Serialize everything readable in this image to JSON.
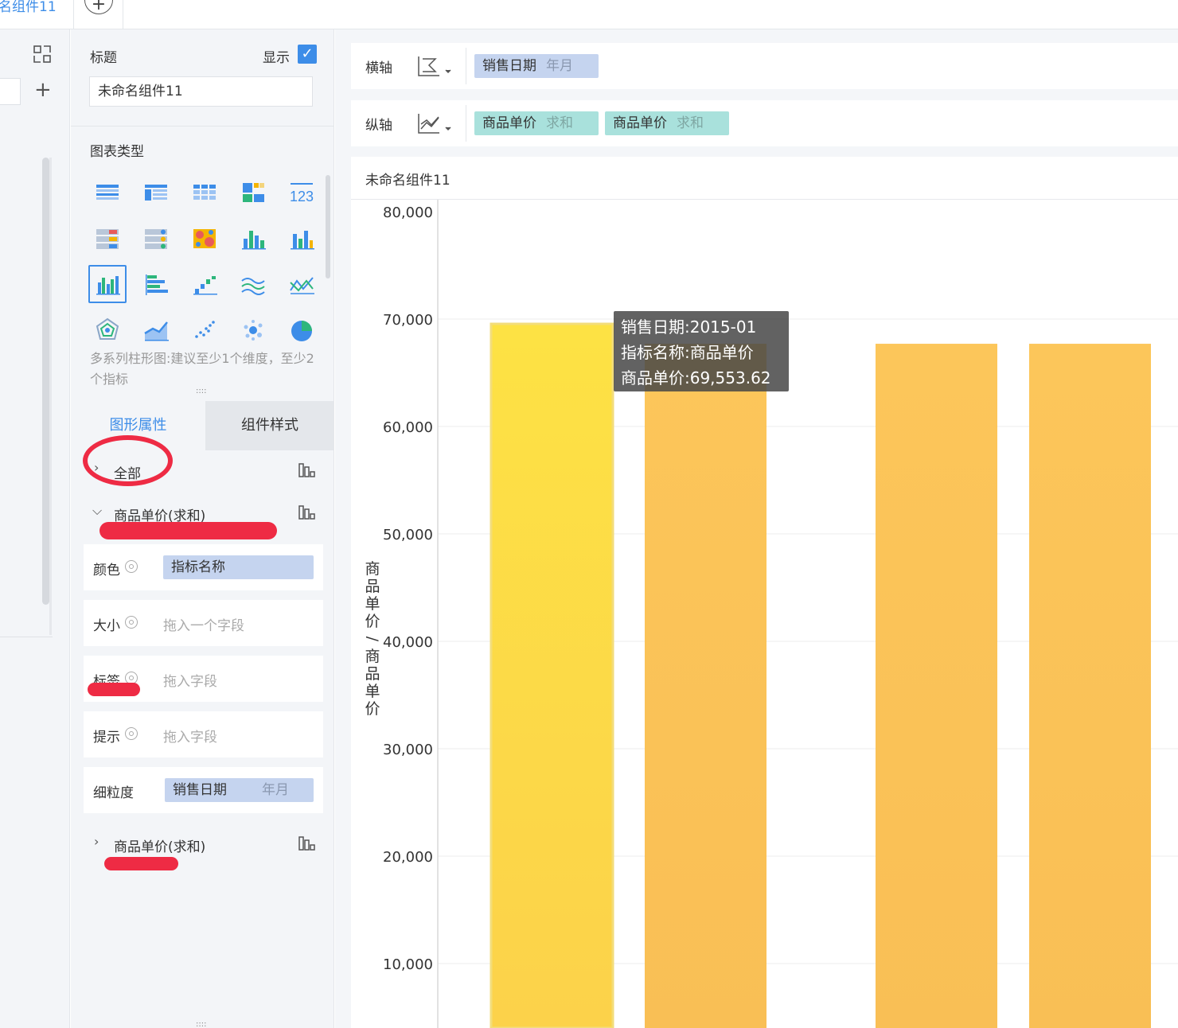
{
  "tabbar": {
    "tab_label": "名组件11",
    "add_label": "+"
  },
  "panel": {
    "title_label": "标题",
    "show_label": "显示",
    "title_value": "未命名组件11",
    "chart_type_label": "图表类型",
    "chart_type_desc": "多系列柱形图:建议至少1个维度，至少2个指标",
    "tabs": {
      "shape": "图形属性",
      "style": "组件样式"
    },
    "all_label": "全部",
    "series1_label": "商品单价(求和)",
    "series2_label": "商品单价(求和)",
    "fields": {
      "color": {
        "name": "颜色",
        "value": "指标名称"
      },
      "size": {
        "name": "大小",
        "placeholder": "拖入一个字段"
      },
      "label": {
        "name": "标签",
        "placeholder": "拖入字段"
      },
      "tip": {
        "name": "提示",
        "placeholder": "拖入字段"
      },
      "granularity": {
        "name": "细粒度",
        "value": "销售日期",
        "sub": "年月"
      }
    }
  },
  "axis": {
    "x_label": "横轴",
    "y_label": "纵轴",
    "x_pill": {
      "name": "销售日期",
      "sub": "年月"
    },
    "y_pills": [
      {
        "name": "商品单价",
        "sub": "求和"
      },
      {
        "name": "商品单价",
        "sub": "求和"
      }
    ]
  },
  "widget": {
    "title": "未命名组件11"
  },
  "tooltip": {
    "line1": "销售日期:2015-01",
    "line2": "指标名称:商品单价",
    "line3": "商品单价:69,553.62"
  },
  "colors": {
    "accent": "#3d8de8",
    "bar_highlight": "#fde244",
    "bar": "#fcc65a",
    "annotation": "#ee2b44"
  },
  "chart_data": {
    "type": "bar",
    "title": "",
    "ylabel": "商品单价/商品单价",
    "ylim": [
      0,
      80000
    ],
    "yticks": [
      "80,000",
      "70,000",
      "60,000",
      "50,000",
      "40,000",
      "30,000",
      "20,000",
      "10,000"
    ],
    "series": [
      {
        "name": "商品单价",
        "values": [
          69553.62,
          67700,
          67700
        ]
      },
      {
        "name": "商品单价",
        "values": [
          67700,
          null,
          67700
        ]
      }
    ]
  }
}
